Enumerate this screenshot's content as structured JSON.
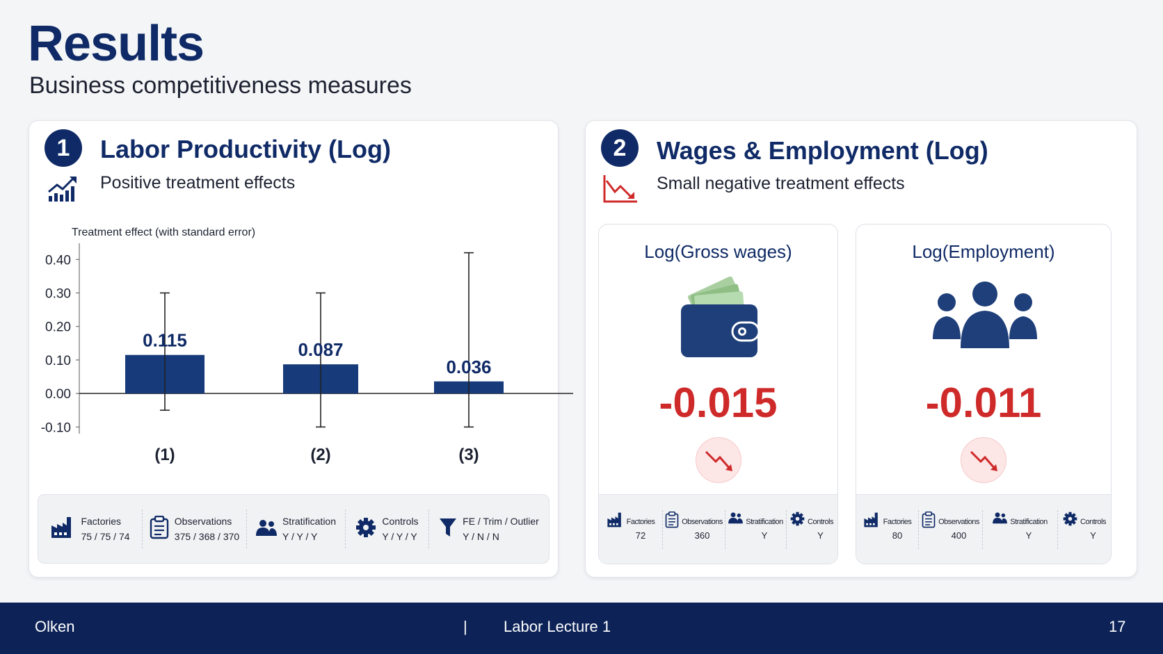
{
  "slide": {
    "title": "Results",
    "subtitle": "Business competitiveness measures",
    "page_number": "17"
  },
  "footer": {
    "author": "Olken",
    "separator": "|",
    "course": "Labor Lecture 1"
  },
  "panel1": {
    "badge": "1",
    "title": "Labor Productivity (Log)",
    "subtitle": "Positive treatment effects",
    "stats": [
      {
        "label": "Factories",
        "value": "75 / 75 / 74",
        "icon": "factory-icon"
      },
      {
        "label": "Observations",
        "value": "375 / 368 / 370",
        "icon": "clipboard-icon"
      },
      {
        "label": "Stratification",
        "value": "Y / Y / Y",
        "icon": "people-icon"
      },
      {
        "label": "Controls",
        "value": "Y / Y / Y",
        "icon": "gear-icon"
      },
      {
        "label": "FE / Trim / Outlier",
        "value": "Y / N / N",
        "icon": "filter-icon"
      }
    ]
  },
  "panel2": {
    "badge": "2",
    "title": "Wages & Employment (Log)",
    "subtitle": "Small negative treatment effects",
    "wages": {
      "title": "Log(Gross wages)",
      "value": "-0.015",
      "stats": [
        {
          "label": "Factories",
          "value": "72",
          "icon": "factory-icon"
        },
        {
          "label": "Observations",
          "value": "360",
          "icon": "clipboard-icon"
        },
        {
          "label": "Stratification",
          "value": "Y",
          "icon": "people-icon"
        },
        {
          "label": "Controls",
          "value": "Y",
          "icon": "gear-icon"
        }
      ]
    },
    "employment": {
      "title": "Log(Employment)",
      "value": "-0.011",
      "stats": [
        {
          "label": "Factories",
          "value": "80",
          "icon": "factory-icon"
        },
        {
          "label": "Observations",
          "value": "400",
          "icon": "clipboard-icon"
        },
        {
          "label": "Stratification",
          "value": "Y",
          "icon": "people-icon"
        },
        {
          "label": "Controls",
          "value": "Y",
          "icon": "gear-icon"
        }
      ]
    }
  },
  "colors": {
    "navy": "#0f2a66",
    "red": "#cf2a2a",
    "footer": "#0d2357"
  },
  "chart_data": {
    "type": "bar",
    "ylabel": "Treatment effect (with standard error)",
    "categories": [
      "(1)",
      "(2)",
      "(3)"
    ],
    "values": [
      0.115,
      0.087,
      0.036
    ],
    "value_labels": [
      "0.115",
      "0.087",
      "0.036"
    ],
    "error_low": [
      -0.05,
      -0.1,
      -0.1
    ],
    "error_high": [
      0.3,
      0.3,
      0.42
    ],
    "yticks": [
      -0.1,
      0.0,
      0.1,
      0.2,
      0.3,
      0.4
    ],
    "ytick_labels": [
      "-0.10",
      "0.00",
      "0.10",
      "0.20",
      "0.30",
      "0.40"
    ],
    "ylim": [
      -0.12,
      0.44
    ],
    "grid": false
  }
}
